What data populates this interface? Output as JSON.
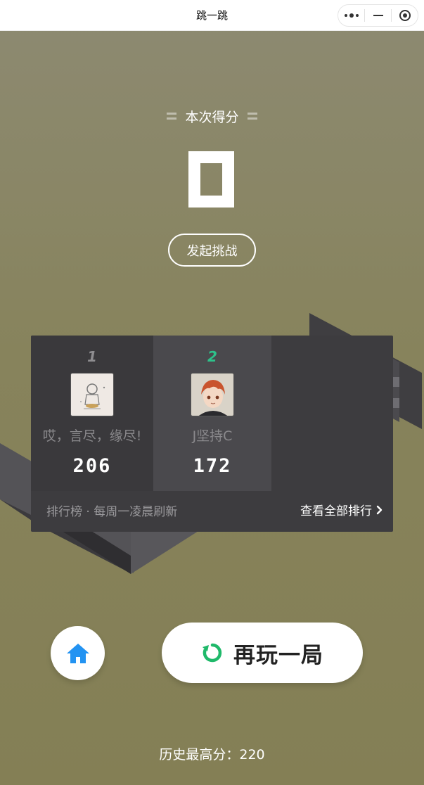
{
  "window": {
    "title": "跳一跳"
  },
  "result": {
    "score_label": "本次得分",
    "score": 0,
    "challenge_label": "发起挑战"
  },
  "leaderboard": {
    "entries": [
      {
        "rank": "1",
        "name": "哎，言尽，缘尽!",
        "score": "206",
        "rank_color": "#8e8d90"
      },
      {
        "rank": "2",
        "name": "J坚持C",
        "score": "172",
        "rank_color": "#2ec08a"
      }
    ],
    "footer_note": "排行榜 · 每周一凌晨刷新",
    "view_all_label": "查看全部排行"
  },
  "actions": {
    "home_icon": "home-icon",
    "replay_icon": "replay-icon",
    "replay_label": "再玩一局"
  },
  "history": {
    "best_text": "历史最高分：220"
  },
  "colors": {
    "background": "#87835c",
    "board": "#3d3c3f",
    "accent_green": "#1fb96a",
    "home_blue": "#2393f2"
  }
}
